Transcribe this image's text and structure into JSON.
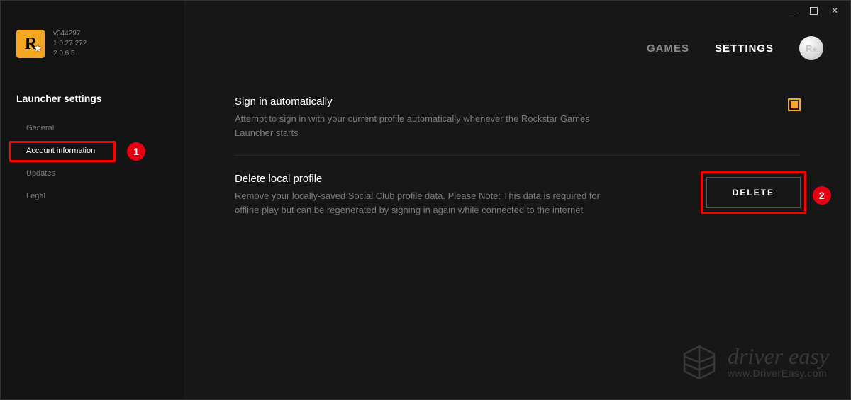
{
  "window": {
    "minimize": "–",
    "maximize": "□",
    "close": "✕"
  },
  "brand": {
    "logo_text": "R",
    "version_line1": "v344297",
    "version_line2": "1.0.27.272",
    "version_line3": "2.0.6.5"
  },
  "sidebar": {
    "section_title": "Launcher settings",
    "items": [
      {
        "label": "General"
      },
      {
        "label": "Account information"
      },
      {
        "label": "Updates"
      },
      {
        "label": "Legal"
      }
    ]
  },
  "annotations": {
    "step1": "1",
    "step2": "2"
  },
  "topnav": {
    "games": "GAMES",
    "settings": "SETTINGS",
    "avatar_text": "R★"
  },
  "settings": {
    "signin": {
      "title": "Sign in automatically",
      "desc": "Attempt to sign in with your current profile automatically whenever the Rockstar Games Launcher starts"
    },
    "delete": {
      "title": "Delete local profile",
      "desc": "Remove your locally-saved Social Club profile data. Please Note: This data is required for offline play but can be regenerated by signing in again while connected to the internet",
      "button": "DELETE"
    }
  },
  "watermark": {
    "brand": "driver easy",
    "url": "www.DriverEasy.com"
  }
}
